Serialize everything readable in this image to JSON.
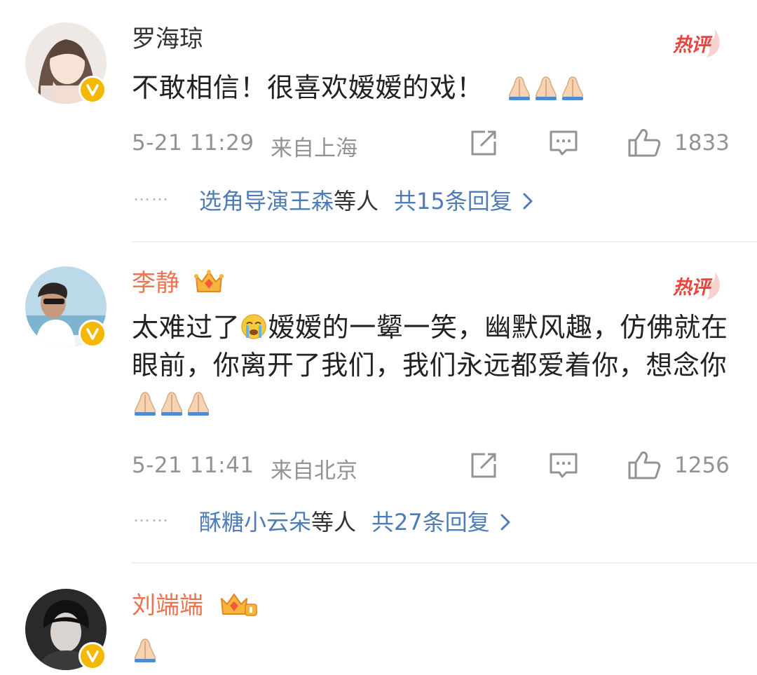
{
  "comments": [
    {
      "username": "罗海琼",
      "hot_label": "热评",
      "text": "不敢相信！很喜欢嫒嫒的戏！",
      "timestamp": "5-21 11:29",
      "location": "来自上海",
      "likes": "1833",
      "reply_users": "选角导演王森",
      "reply_suffix": "等人",
      "reply_count": "共15条回复"
    },
    {
      "username": "李静",
      "hot_label": "热评",
      "text_part1": "太难过了",
      "text_part2": "嫒嫒的一颦一笑，幽默风趣，仿佛就在眼前，你离开了我们，我们永远都爱着你，想念你",
      "timestamp": "5-21 11:41",
      "location": "来自北京",
      "likes": "1256",
      "reply_users": "酥糖小云朵",
      "reply_suffix": "等人",
      "reply_count": "共27条回复"
    },
    {
      "username": "刘端端"
    }
  ],
  "reply_dots": "……",
  "icons": {
    "verified": "verified-v-badge-icon",
    "crown": "member-crown-icon",
    "repost": "repost-icon",
    "comment": "comment-icon",
    "like": "thumbs-up-icon",
    "pray": "folded-hands-emoji-icon",
    "crying": "crying-face-emoji-icon",
    "chevron": "chevron-right-icon"
  },
  "colors": {
    "member_name": "#eb7350",
    "link_blue": "#4d7cb7",
    "hot_red": "#e8433c",
    "meta_gray": "#939393",
    "verified_gold": "#f5b800"
  }
}
